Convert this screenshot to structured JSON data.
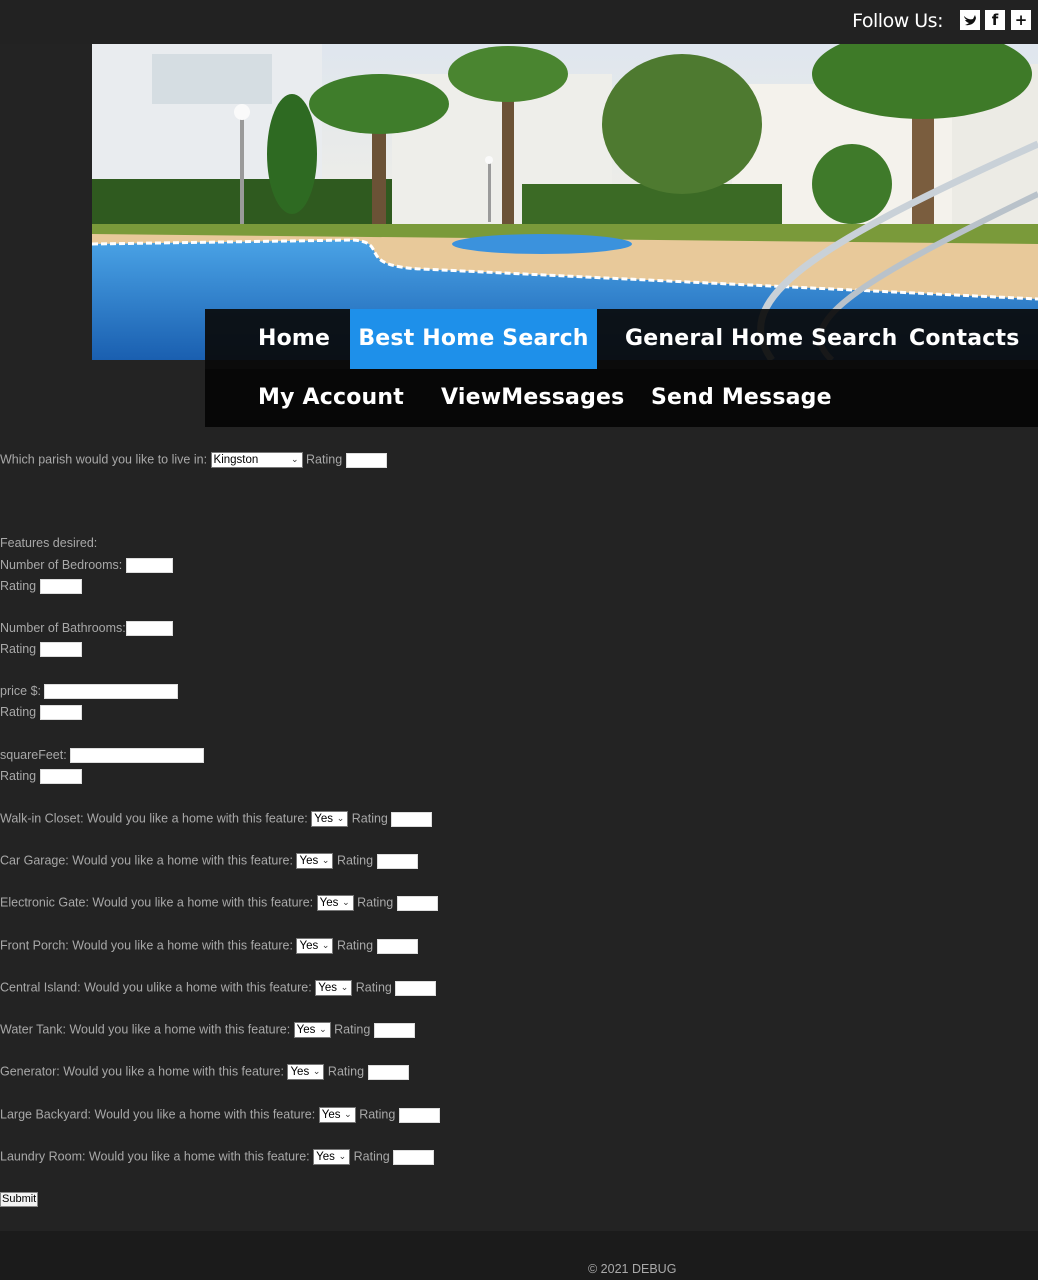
{
  "header": {
    "follow_label": "Follow Us:",
    "social": [
      {
        "icon": "twitter-icon",
        "glyph": "🐦"
      },
      {
        "icon": "facebook-icon",
        "glyph": "f"
      },
      {
        "icon": "plus-icon",
        "glyph": "+"
      }
    ]
  },
  "nav": {
    "row1": [
      {
        "label": "Home",
        "active": false
      },
      {
        "label": "Best Home Search",
        "active": true
      },
      {
        "label": "General Home Search",
        "active": false
      },
      {
        "label": "Contacts",
        "active": false
      }
    ],
    "row2": [
      {
        "label": "My Account"
      },
      {
        "label": "ViewMessages"
      },
      {
        "label": "Send Message"
      }
    ],
    "active_color": "#1e90ea"
  },
  "form": {
    "parish_label": "Which parish would you like to live in:",
    "parish_value": "Kingston",
    "rating_label": "Rating",
    "features_heading": "Features desired:",
    "bedrooms_label": "Number of Bedrooms:",
    "bathrooms_label": "Number of Bathrooms:",
    "price_label": "price $:",
    "sqft_label": "squareFeet:",
    "features": [
      {
        "label": "Walk-in Closet: Would you like a home with this feature:",
        "value": "Yes"
      },
      {
        "label": "Car Garage: Would you like a home with this feature:",
        "value": "Yes"
      },
      {
        "label": "Electronic Gate: Would you like a home with this feature:",
        "value": "Yes"
      },
      {
        "label": "Front Porch: Would you like a home with this feature:",
        "value": "Yes"
      },
      {
        "label": "Central Island: Would you ulike a home with this feature:",
        "value": "Yes"
      },
      {
        "label": "Water Tank: Would you like a home with this feature:",
        "value": "Yes"
      },
      {
        "label": "Generator: Would you like a home with this feature:",
        "value": "Yes"
      },
      {
        "label": "Large Backyard: Would you like a home with this feature:",
        "value": "Yes"
      },
      {
        "label": "Laundry Room: Would you like a home with this feature:",
        "value": "Yes"
      }
    ],
    "submit_label": "Submit"
  },
  "footer": {
    "copyright": "© 2021 DEBUG"
  }
}
